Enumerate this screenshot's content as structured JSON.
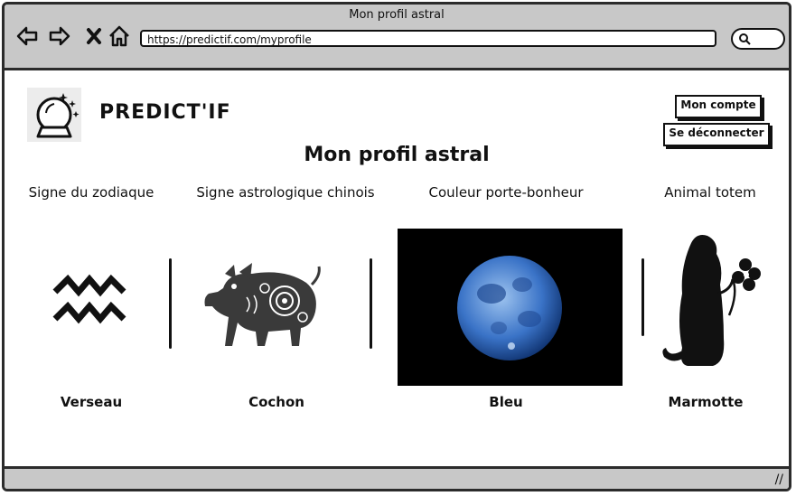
{
  "window": {
    "title": "Mon profil astral"
  },
  "browser": {
    "url": "https://predictif.com/myprofile"
  },
  "app": {
    "brand": "PREDICT'IF"
  },
  "header": {
    "account_button": "Mon compte",
    "logout_button": "Se déconnecter"
  },
  "page": {
    "title": "Mon profil astral"
  },
  "profile": {
    "columns": [
      {
        "heading": "Signe du zodiaque",
        "value": "Verseau",
        "icon": "aquarius-icon"
      },
      {
        "heading": "Signe astrologique chinois",
        "value": "Cochon",
        "icon": "pig-icon"
      },
      {
        "heading": "Couleur porte-bonheur",
        "value": "Bleu",
        "icon": "blue-moon-icon"
      },
      {
        "heading": "Animal totem",
        "value": "Marmotte",
        "icon": "marmot-icon"
      }
    ]
  },
  "colors": {
    "chrome": "#c8c8c8",
    "border": "#2b2b2b",
    "moon": "#3a73c7"
  }
}
